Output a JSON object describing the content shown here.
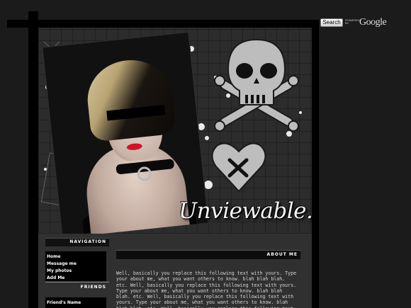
{
  "search": {
    "button_label": "Search",
    "powered_by": "POWERED BY",
    "brand": "Google"
  },
  "header": {
    "title": "Unviewable."
  },
  "navigation": {
    "heading": "NAVIGATION",
    "items": [
      "Home",
      "Message me",
      "My photos",
      "Add Me"
    ]
  },
  "friends": {
    "heading": "FRIENDS",
    "items": [
      "Friend's Name"
    ]
  },
  "about": {
    "heading": "ABOUT ME",
    "body": "Well, basically you replace this following text with yours. Type your about me, what you want others to know. blah blah blah. etc. Well, basically you replace this following text with yours. Type your about me, what you want others to know. blah blah blah. etc. Well, basically you replace this following text with yours. Type your about me, what you want others to know. blah blah blah. etc. Well, basically you replace this following text with yours. Type your about me, what you want others to know. blah blah blah. etc. Well, basically you replace this following text with yours. Type your about me, what you want others to know. blah blah blah. etc. Well,"
  },
  "icons": {
    "skull": "skull-crossbones-icon",
    "heart": "stitched-heart-icon"
  },
  "colors": {
    "background": "#1b1b1b",
    "frame": "#000000",
    "header": "#2c2c2c",
    "content": "#303030",
    "lips": "#d01325"
  }
}
